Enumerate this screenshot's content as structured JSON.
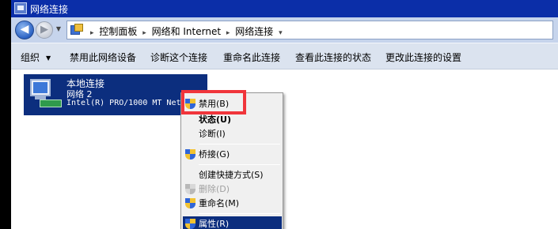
{
  "window": {
    "title": "网络连接"
  },
  "nav": {
    "back_glyph": "◀",
    "forward_glyph": "▶",
    "history_glyph": "▼",
    "crumbs": [
      "控制面板",
      "网络和 Internet",
      "网络连接"
    ],
    "crumb_sep": "▸",
    "dropdown_glyph": "▾"
  },
  "commands": {
    "organize": "组织",
    "caret": "▼",
    "disable_device": "禁用此网络设备",
    "diagnose": "诊断这个连接",
    "rename": "重命名此连接",
    "view_status": "查看此连接的状态",
    "change_settings": "更改此连接的设置"
  },
  "connection": {
    "name": "本地连接",
    "network": "网络  2",
    "device": "Intel(R) PRO/1000 MT Net"
  },
  "context_menu": {
    "disable": "禁用(B)",
    "status": "状态(U)",
    "diagnose": "诊断(I)",
    "bridge": "桥接(G)",
    "create_shortcut": "创建快捷方式(S)",
    "delete": "删除(D)",
    "rename": "重命名(M)",
    "properties": "属性(R)"
  },
  "colors": {
    "highlight_box": "#f0353b",
    "selection": "#0c2e7e",
    "titlebar": "#0b2ea8"
  }
}
